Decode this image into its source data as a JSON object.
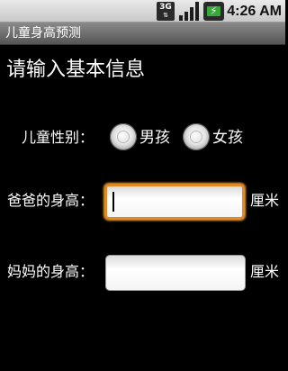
{
  "status_bar": {
    "network_type": "3G",
    "network_arrows": "⇅",
    "battery_glyph": "⚡",
    "time": "4:26 AM",
    "icons": [
      "3g-data-icon",
      "signal-strength-icon",
      "battery-charging-icon"
    ]
  },
  "app": {
    "title": "儿童身高预测"
  },
  "form": {
    "heading": "请输入基本信息",
    "gender": {
      "label": "儿童性别：",
      "options": [
        {
          "label": "男孩",
          "selected": false
        },
        {
          "label": "女孩",
          "selected": false
        }
      ]
    },
    "father_height": {
      "label": "爸爸的身高：",
      "value": "",
      "placeholder": "",
      "unit": "厘米",
      "focused": true
    },
    "mother_height": {
      "label": "妈妈的身高：",
      "value": "",
      "placeholder": "",
      "unit": "厘米",
      "focused": false
    }
  },
  "colors": {
    "background": "#000000",
    "focus_ring": "#e3891f",
    "battery_green": "#39a83a"
  }
}
